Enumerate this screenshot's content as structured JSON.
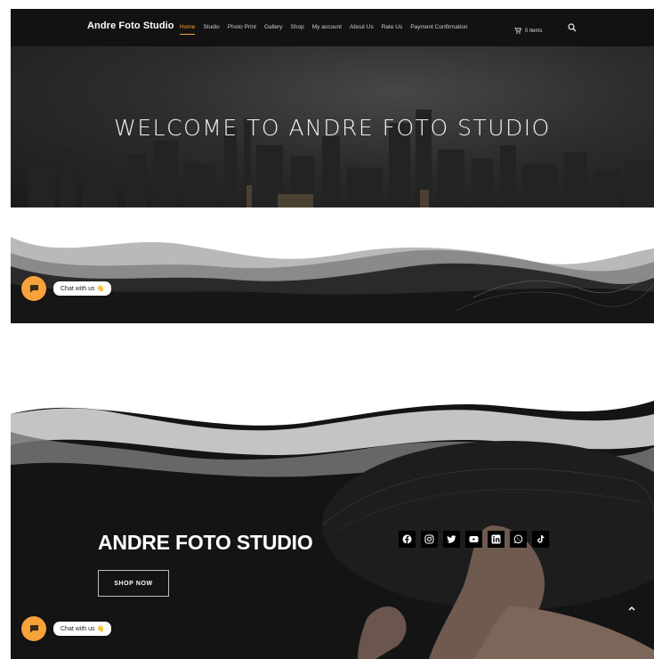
{
  "nav": {
    "brand": "Andre Foto Studio",
    "items": [
      "Home",
      "Studio",
      "Photo Print",
      "Gallery",
      "Shop",
      "My account",
      "About Us",
      "Rate Us",
      "Payment Confirmation"
    ],
    "active_item": "Home",
    "cart_label": "0 items",
    "accent_color": "#f0a536"
  },
  "hero": {
    "title": "WELCOME TO ANDRE FOTO STUDIO"
  },
  "section2": {
    "title": "ANDRE FOTO STUDIO",
    "shop_button": "SHOP NOW",
    "social_icons": [
      "facebook-icon",
      "instagram-icon",
      "twitter-icon",
      "youtube-icon",
      "linkedin-icon",
      "whatsapp-icon",
      "tiktok-icon"
    ]
  },
  "chat": {
    "label": "Chat with us 👋",
    "bubble_color": "#f7a23b"
  },
  "icons": {
    "cart": "cart-icon",
    "search": "search-icon",
    "scroll_top": "chevron-up-icon"
  }
}
